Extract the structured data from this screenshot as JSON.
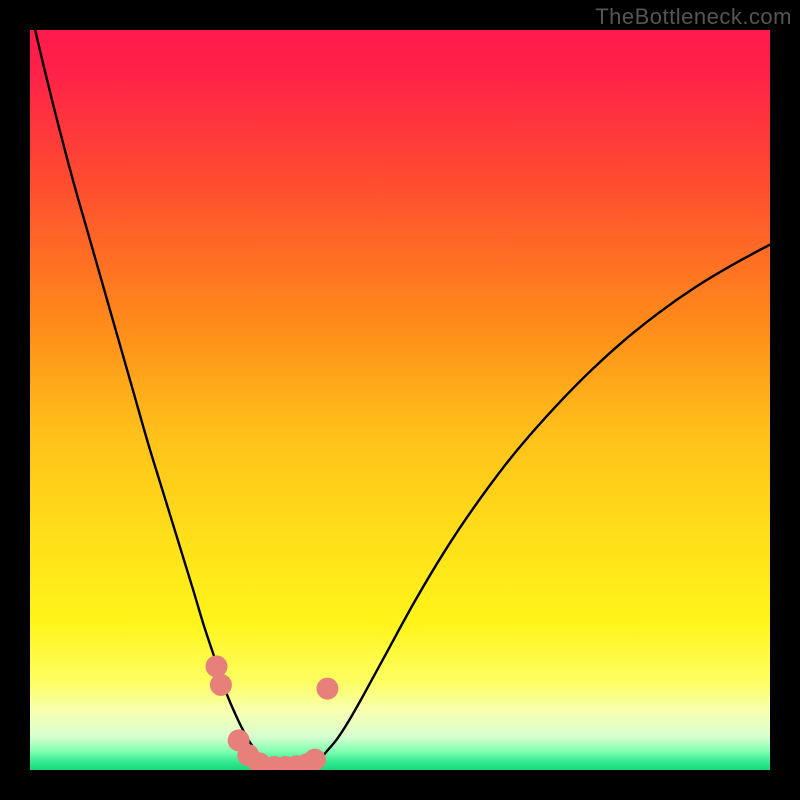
{
  "watermark": "TheBottleneck.com",
  "colors": {
    "frame": "#000000",
    "gradient_stops": [
      {
        "offset": 0.0,
        "color": "#ff1a4d"
      },
      {
        "offset": 0.06,
        "color": "#ff2248"
      },
      {
        "offset": 0.2,
        "color": "#ff4a30"
      },
      {
        "offset": 0.4,
        "color": "#ff8c1a"
      },
      {
        "offset": 0.55,
        "color": "#ffc21a"
      },
      {
        "offset": 0.7,
        "color": "#ffe21a"
      },
      {
        "offset": 0.8,
        "color": "#fff41a"
      },
      {
        "offset": 0.88,
        "color": "#fdff60"
      },
      {
        "offset": 0.92,
        "color": "#f8ffb0"
      },
      {
        "offset": 0.955,
        "color": "#d8ffd0"
      },
      {
        "offset": 0.975,
        "color": "#80ffb0"
      },
      {
        "offset": 0.99,
        "color": "#30e890"
      },
      {
        "offset": 1.0,
        "color": "#18d878"
      }
    ],
    "curve": "#000000",
    "marker_fill": "#e77f7a",
    "marker_stroke": "#d86a65"
  },
  "chart_data": {
    "type": "line",
    "title": "",
    "xlabel": "",
    "ylabel": "",
    "xlim": [
      0,
      100
    ],
    "ylim": [
      0,
      100
    ],
    "curve_left": {
      "comment": "Left branch of valley curve, x in 0..~33",
      "x": [
        0.0,
        2.0,
        4.0,
        6.0,
        8.0,
        10.0,
        12.0,
        14.0,
        16.0,
        18.0,
        20.0,
        22.0,
        23.5,
        25.0,
        26.5,
        28.0,
        29.0,
        30.0,
        31.0,
        32.0,
        33.0
      ],
      "y": [
        103.0,
        94.5,
        86.5,
        79.0,
        72.0,
        65.0,
        58.0,
        51.0,
        44.0,
        37.5,
        31.0,
        24.5,
        19.5,
        15.0,
        10.5,
        7.0,
        5.0,
        3.3,
        2.0,
        1.0,
        0.4
      ]
    },
    "curve_right": {
      "comment": "Right branch of valley curve, x in ~38..100",
      "x": [
        38.0,
        39.0,
        40.0,
        41.5,
        43.0,
        45.0,
        48.0,
        52.0,
        56.0,
        60.0,
        65.0,
        70.0,
        75.0,
        80.0,
        85.0,
        90.0,
        95.0,
        100.0
      ],
      "y": [
        0.4,
        1.2,
        2.4,
        4.2,
        6.5,
        10.0,
        15.5,
        22.8,
        29.5,
        35.5,
        42.2,
        48.0,
        53.2,
        57.8,
        61.8,
        65.3,
        68.3,
        71.0
      ]
    },
    "markers": {
      "comment": "Pink markers near valley floor",
      "x": [
        25.2,
        25.8,
        28.2,
        29.5,
        31.0,
        33.0,
        34.5,
        36.0,
        37.5,
        38.5,
        40.2
      ],
      "y": [
        14.0,
        11.5,
        4.0,
        2.0,
        0.9,
        0.4,
        0.4,
        0.5,
        0.8,
        1.4,
        11.0
      ],
      "r": [
        11,
        11,
        11,
        11,
        11,
        11,
        11,
        11,
        11,
        11,
        11
      ]
    }
  }
}
